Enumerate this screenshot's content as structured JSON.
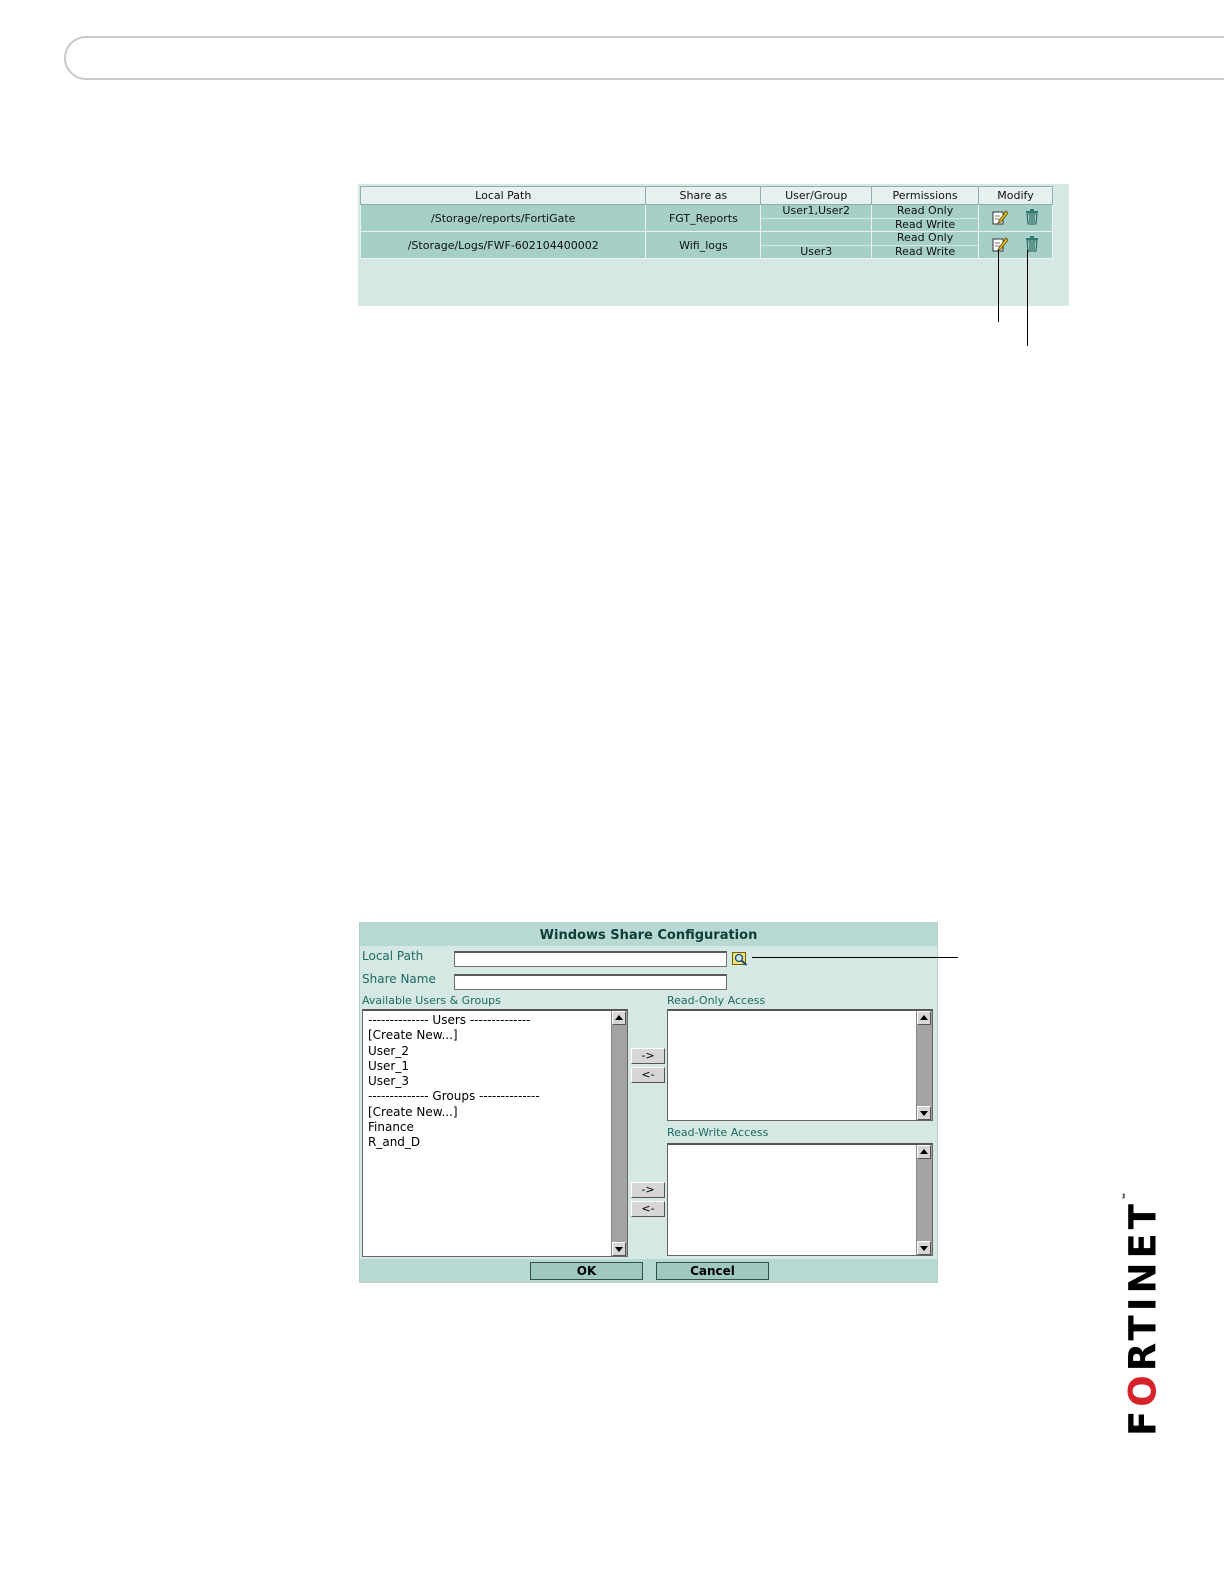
{
  "shares_table": {
    "columns": [
      "Local Path",
      "Share as",
      "User/Group",
      "Permissions",
      "Modify"
    ],
    "rows": [
      {
        "local_path": "/Storage/reports/FortiGate",
        "share_as": "FGT_Reports",
        "users": [
          "User1,User2",
          ""
        ],
        "permissions": [
          "Read Only",
          "Read Write"
        ]
      },
      {
        "local_path": "/Storage/Logs/FWF-602104400002",
        "share_as": "Wifi_logs",
        "users": [
          "",
          "User3"
        ],
        "permissions": [
          "Read Only",
          "Read Write"
        ]
      }
    ]
  },
  "share_dialog": {
    "title": "Windows Share Configuration",
    "local_path_label": "Local Path",
    "local_path_value": "",
    "share_name_label": "Share Name",
    "share_name_value": "",
    "available_label": "Available Users & Groups",
    "available_items": [
      "-------------- Users --------------",
      "[Create New...]",
      "User_2",
      "User_1",
      "User_3",
      "-------------- Groups --------------",
      "[Create New...]",
      "Finance",
      "R_and_D"
    ],
    "read_only_label": "Read-Only Access",
    "read_write_label": "Read-Write Access",
    "add_label": "->",
    "remove_label": "<-",
    "ok_label": "OK",
    "cancel_label": "Cancel"
  },
  "brand": {
    "pre": "F",
    "accent": "O",
    "post": "RTINET",
    "tm": "™",
    "accent_color": "#d8222a"
  }
}
